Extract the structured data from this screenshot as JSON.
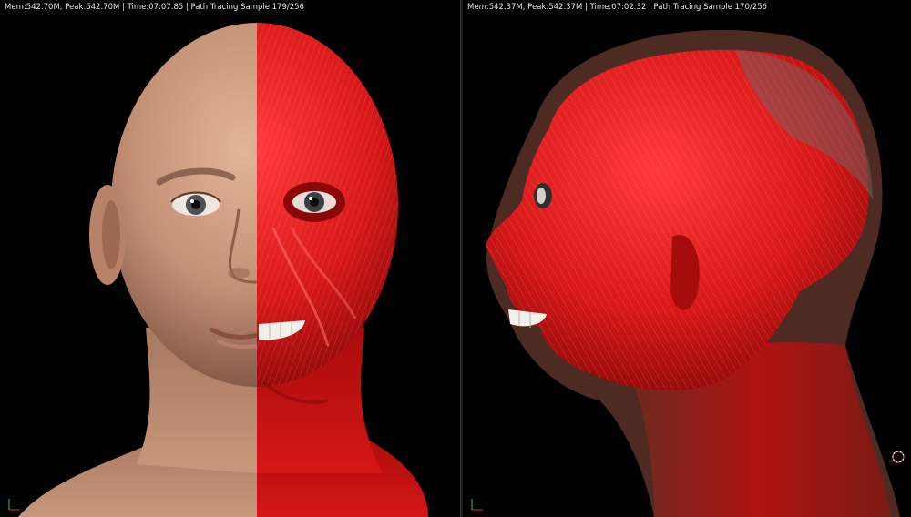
{
  "viewport_left": {
    "stats": "Mem:542.70M, Peak:542.70M | Time:07:07.85 | Path Tracing Sample 179/256"
  },
  "viewport_right": {
    "stats": "Mem:542.37M, Peak:542.37M | Time:07:02.32 | Path Tracing Sample 170/256"
  },
  "icons": {
    "axis": "axis-gizmo-icon",
    "cursor": "3d-cursor-icon"
  },
  "colors": {
    "background": "#000000",
    "skin": "#c99a7c",
    "muscle": "#d81818",
    "text": "#e8e8e8"
  }
}
